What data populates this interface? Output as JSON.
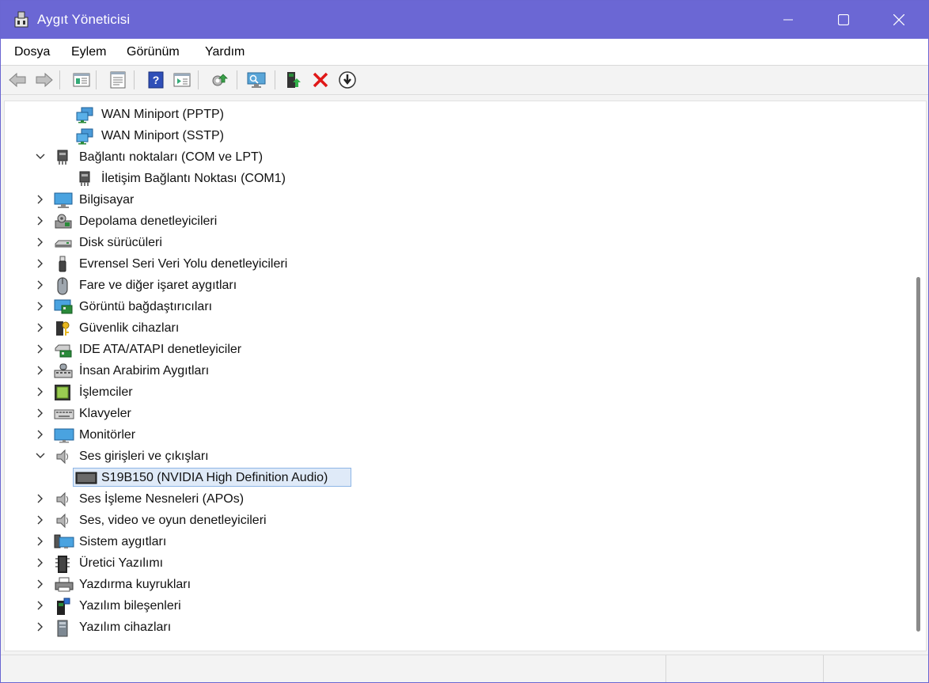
{
  "window": {
    "title": "Aygıt Yöneticisi",
    "accent_color": "#6b67d4",
    "controls": {
      "minimize_icon": "minimize-icon",
      "maximize_icon": "maximize-icon",
      "close_icon": "close-icon"
    }
  },
  "menu": {
    "items": [
      {
        "label": "Dosya"
      },
      {
        "label": "Eylem"
      },
      {
        "label": "Görünüm"
      },
      {
        "label": "Yardım"
      }
    ]
  },
  "toolbar": {
    "buttons": [
      {
        "icon": "back-arrow-icon"
      },
      {
        "icon": "forward-arrow-icon"
      },
      {
        "icon": "show-hide-console-tree-icon"
      },
      {
        "icon": "properties-icon"
      },
      {
        "icon": "help-icon"
      },
      {
        "icon": "action-pane-icon"
      },
      {
        "icon": "update-driver-icon"
      },
      {
        "icon": "scan-hardware-icon"
      },
      {
        "icon": "enable-device-icon"
      },
      {
        "icon": "uninstall-device-icon"
      },
      {
        "icon": "disable-device-icon"
      }
    ]
  },
  "tree": {
    "items": [
      {
        "label": "WAN Miniport (PPTP)",
        "level": 1,
        "icon": "network-adapter-icon"
      },
      {
        "label": "WAN Miniport (SSTP)",
        "level": 1,
        "icon": "network-adapter-icon"
      },
      {
        "label": "Bağlantı noktaları (COM ve LPT)",
        "level": 0,
        "expanded": true,
        "icon": "port-icon"
      },
      {
        "label": "İletişim Bağlantı Noktası (COM1)",
        "level": 1,
        "icon": "port-icon"
      },
      {
        "label": "Bilgisayar",
        "level": 0,
        "expanded": false,
        "icon": "computer-icon"
      },
      {
        "label": "Depolama denetleyicileri",
        "level": 0,
        "expanded": false,
        "icon": "storage-controller-icon"
      },
      {
        "label": "Disk sürücüleri",
        "level": 0,
        "expanded": false,
        "icon": "disk-drive-icon"
      },
      {
        "label": "Evrensel Seri Veri Yolu denetleyicileri",
        "level": 0,
        "expanded": false,
        "icon": "usb-icon"
      },
      {
        "label": "Fare ve diğer işaret aygıtları",
        "level": 0,
        "expanded": false,
        "icon": "mouse-icon"
      },
      {
        "label": "Görüntü bağdaştırıcıları",
        "level": 0,
        "expanded": false,
        "icon": "display-adapter-icon"
      },
      {
        "label": "Güvenlik cihazları",
        "level": 0,
        "expanded": false,
        "icon": "security-device-icon"
      },
      {
        "label": "IDE ATA/ATAPI denetleyiciler",
        "level": 0,
        "expanded": false,
        "icon": "ide-controller-icon"
      },
      {
        "label": "İnsan Arabirim Aygıtları",
        "level": 0,
        "expanded": false,
        "icon": "hid-icon"
      },
      {
        "label": "İşlemciler",
        "level": 0,
        "expanded": false,
        "icon": "processor-icon"
      },
      {
        "label": "Klavyeler",
        "level": 0,
        "expanded": false,
        "icon": "keyboard-icon"
      },
      {
        "label": "Monitörler",
        "level": 0,
        "expanded": false,
        "icon": "monitor-icon"
      },
      {
        "label": "Ses girişleri ve çıkışları",
        "level": 0,
        "expanded": true,
        "icon": "speaker-icon"
      },
      {
        "label": "S19B150 (NVIDIA High Definition Audio)",
        "level": 1,
        "selected": true,
        "icon": "monitor-device-icon"
      },
      {
        "label": "Ses İşleme Nesneleri (APOs)",
        "level": 0,
        "expanded": false,
        "icon": "speaker-icon"
      },
      {
        "label": "Ses, video ve oyun denetleyicileri",
        "level": 0,
        "expanded": false,
        "icon": "speaker-icon"
      },
      {
        "label": "Sistem aygıtları",
        "level": 0,
        "expanded": false,
        "icon": "system-devices-icon"
      },
      {
        "label": "Üretici Yazılımı",
        "level": 0,
        "expanded": false,
        "icon": "firmware-icon"
      },
      {
        "label": "Yazdırma kuyrukları",
        "level": 0,
        "expanded": false,
        "icon": "printer-icon"
      },
      {
        "label": "Yazılım bileşenleri",
        "level": 0,
        "expanded": false,
        "icon": "software-component-icon"
      },
      {
        "label": "Yazılım cihazları",
        "level": 0,
        "expanded": false,
        "icon": "software-device-icon"
      }
    ]
  },
  "statusbar": {
    "cells": [
      "",
      "",
      ""
    ]
  }
}
